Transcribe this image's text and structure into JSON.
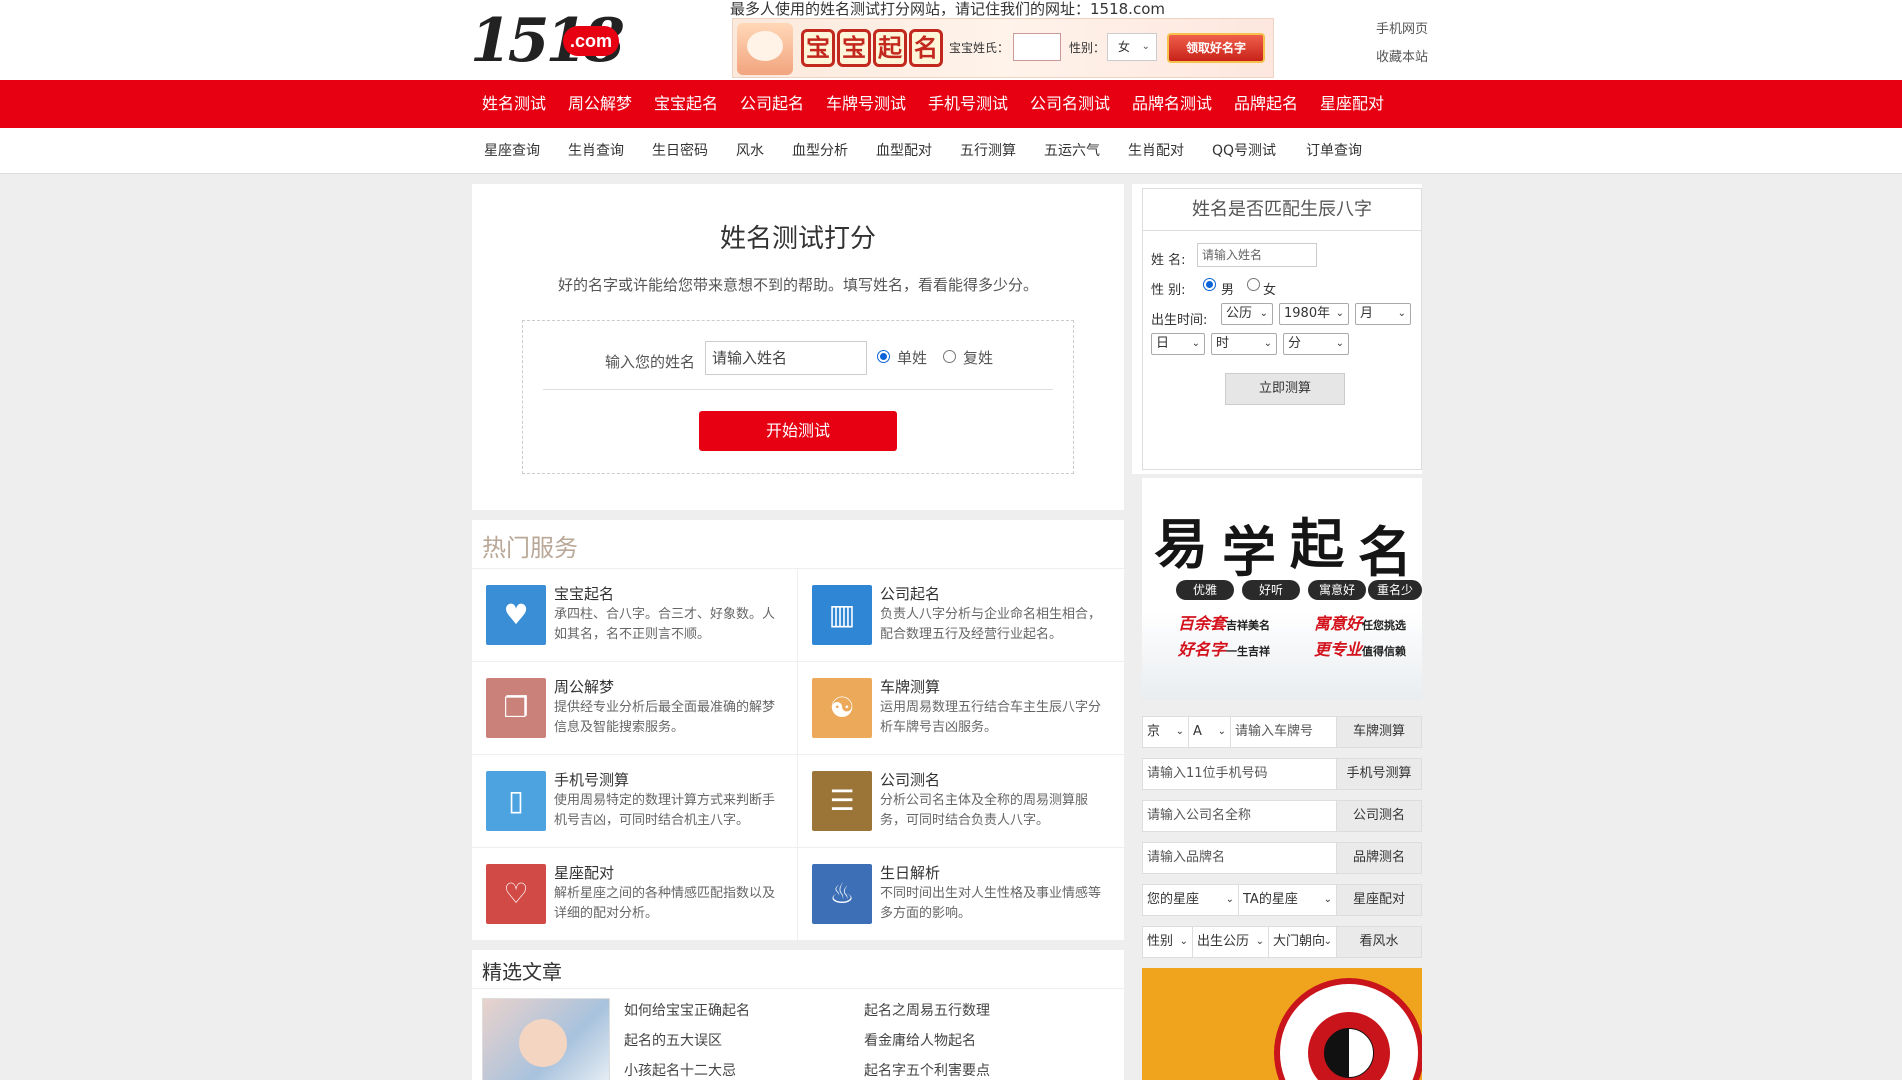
{
  "header": {
    "logo_num": "1518",
    "logo_dot": ".com",
    "slogan": "最多人使用的姓名测试打分网站，请记住我们的网址：1518.com",
    "banner": {
      "chars": [
        "宝",
        "宝",
        "起",
        "名"
      ],
      "name_label": "宝宝姓氏：",
      "sex_label": "性别：",
      "sex_value": "女",
      "button": "领取好名字"
    },
    "links": {
      "mobile": "手机网页",
      "favorite": "收藏本站"
    }
  },
  "main_nav": [
    "姓名测试",
    "周公解梦",
    "宝宝起名",
    "公司起名",
    "车牌号测试",
    "手机号测试",
    "公司名测试",
    "品牌名测试",
    "品牌起名",
    "星座配对"
  ],
  "sub_nav": [
    "星座查询",
    "生肖查询",
    "生日密码",
    "风水",
    "血型分析",
    "血型配对",
    "五行测算",
    "五运六气",
    "生肖配对",
    "QQ号测试",
    "订单查询"
  ],
  "test": {
    "title": "姓名测试打分",
    "subtitle": "好的名字或许能给您带来意想不到的帮助。填写姓名，看看能得多少分。",
    "label": "输入您的姓名",
    "placeholder": "请输入姓名",
    "radio_single": "单姓",
    "radio_double": "复姓",
    "button": "开始测试"
  },
  "hot": {
    "title": "热门服务",
    "items": [
      {
        "title": "宝宝起名",
        "desc": "承四柱、合八字。合三才、好象数。人如其名，名不正则言不顺。",
        "icon": "baby-bottle-icon",
        "color": "#3a8ed6",
        "glyph": "♥"
      },
      {
        "title": "公司起名",
        "desc": "负责人八字分析与企业命名相生相合，配合数理五行及经营行业起名。",
        "icon": "building-icon",
        "color": "#2f86d4",
        "glyph": "▥"
      },
      {
        "title": "周公解梦",
        "desc": "提供经专业分析后最全面最准确的解梦信息及智能搜索服务。",
        "icon": "book-icon",
        "color": "#c9817a",
        "glyph": "❐"
      },
      {
        "title": "车牌测算",
        "desc": "运用周易数理五行结合车主生辰八字分析车牌号吉凶服务。",
        "icon": "bagua-icon",
        "color": "#eda95a",
        "glyph": "☯"
      },
      {
        "title": "手机号测算",
        "desc": "使用周易特定的数理计算方式来判断手机号吉凶，可同时结合机主八字。",
        "icon": "mobile-phone-icon",
        "color": "#4da3e0",
        "glyph": "▯"
      },
      {
        "title": "公司测名",
        "desc": "分析公司名主体及全称的周易测算服务，可同时结合负责人八字。",
        "icon": "document-icon",
        "color": "#9b7537",
        "glyph": "☰"
      },
      {
        "title": "星座配对",
        "desc": "解析星座之间的各种情感匹配指数以及详细的配对分析。",
        "icon": "hearts-icon",
        "color": "#d24a45",
        "glyph": "♡"
      },
      {
        "title": "生日解析",
        "desc": "不同时间出生对人生性格及事业情感等多方面的影响。",
        "icon": "birthday-cake-icon",
        "color": "#3d6fb6",
        "glyph": "♨"
      }
    ]
  },
  "articles": {
    "title": "精选文章",
    "left": [
      "如何给宝宝正确起名",
      "起名的五大误区",
      "小孩起名十二大忌"
    ],
    "right": [
      "起名之周易五行数理",
      "看金庸给人物起名",
      "起名字五个利害要点"
    ]
  },
  "bazi": {
    "title": "姓名是否匹配生辰八字",
    "name_label": "姓 名:",
    "name_placeholder": "请输入姓名",
    "sex_label": "性 别:",
    "male": "男",
    "female": "女",
    "birth_label": "出生时间:",
    "calendar": "公历",
    "year": "1980年",
    "month": "月",
    "day": "日",
    "hour": "时",
    "minute": "分",
    "button": "立即测算"
  },
  "ad_yixue": {
    "chars": [
      "易",
      "学",
      "起",
      "名"
    ],
    "tags": [
      "优雅",
      "好听",
      "寓意好",
      "重名少"
    ],
    "line1_red_a": "百余套",
    "line1_blk_a": "吉祥美名",
    "line1_red_b": "寓意好",
    "line1_blk_b": "任您挑选",
    "line2_red_a": "好名字",
    "line2_blk_a": "一生吉祥",
    "line2_red_b": "更专业",
    "line2_blk_b": "值得信赖"
  },
  "quick": {
    "plate_province": "京",
    "plate_letter": "A",
    "plate_placeholder": "请输入车牌号",
    "plate_button": "车牌测算",
    "phone_placeholder": "请输入11位手机号码",
    "phone_button": "手机号测算",
    "company_placeholder": "请输入公司名全称",
    "company_button": "公司测名",
    "brand_placeholder": "请输入品牌名",
    "brand_button": "品牌测名",
    "star_mine": "您的星座",
    "star_ta": "TA的星座",
    "star_button": "星座配对",
    "fs_sex": "性别",
    "fs_birth": "出生公历",
    "fs_door": "大门朝向",
    "fs_button": "看风水"
  }
}
